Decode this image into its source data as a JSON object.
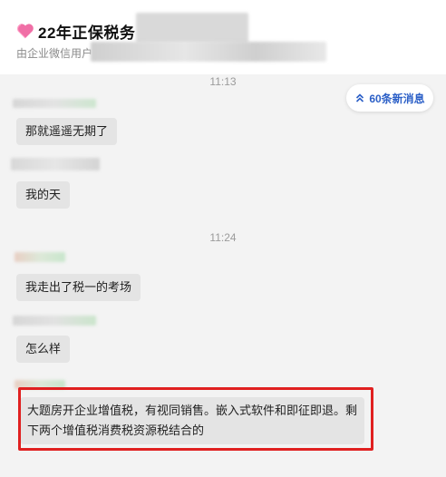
{
  "header": {
    "title": "22年正保税务",
    "subtitle": "由企业微信用户",
    "icons": {
      "title": "heart-icon"
    }
  },
  "new_messages": {
    "label": "60条新消息",
    "icon": "double-chevron-up-icon"
  },
  "timestamps": [
    "11:13",
    "11:24"
  ],
  "messages": [
    {
      "text": "那就遥遥无期了"
    },
    {
      "text": "我的天"
    },
    {
      "text": "我走出了税一的考场"
    },
    {
      "text": "怎么样"
    },
    {
      "text": "大题房开企业增值税，有视同销售。嵌入式软件和即征即退。剩下两个增值税消费税资源税结合的"
    }
  ],
  "colors": {
    "accent": "#2b5fc7",
    "highlight": "#e02020",
    "bubble": "#e4e4e4",
    "background": "#f3f3f3"
  }
}
